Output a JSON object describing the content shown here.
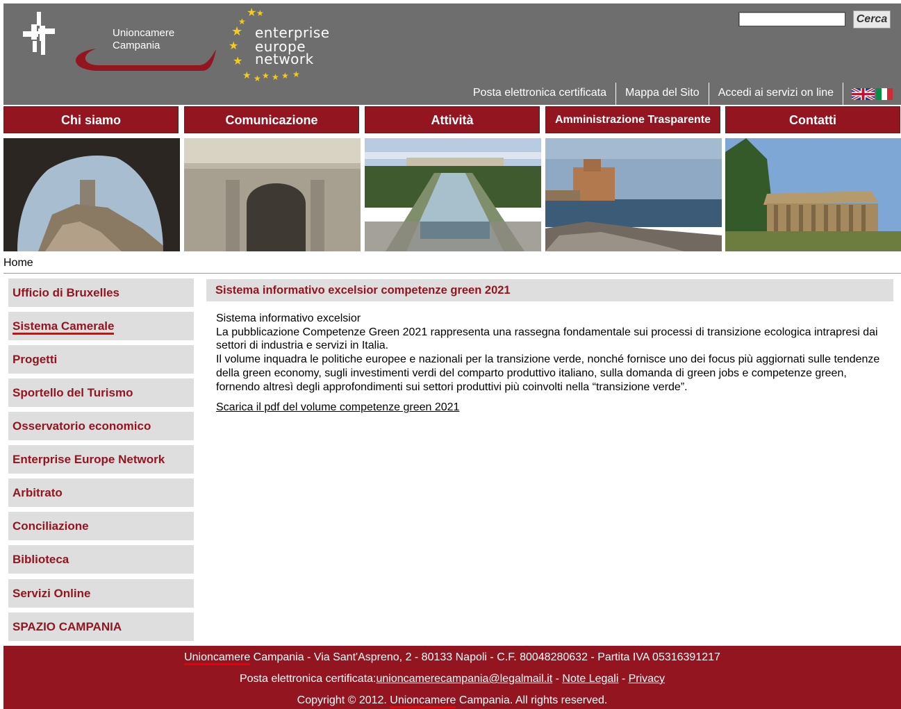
{
  "header": {
    "logo_uc_lines": [
      "Unioncamere",
      "Campania"
    ],
    "logo_een_lines": [
      "enterprise",
      "europe",
      "network"
    ],
    "search": {
      "value": "",
      "button_label": "Cerca"
    },
    "top_links": [
      "Posta elettronica certificata",
      "Mappa del Sito",
      "Accedi ai servizi on line"
    ],
    "flags": [
      "uk-flag-icon",
      "italy-flag-icon"
    ]
  },
  "nav": {
    "items": [
      "Chi siamo",
      "Comunicazione",
      "Attività",
      "Amministrazione Trasparente",
      "Contatti"
    ]
  },
  "photos": [
    "arch-ruins-photo",
    "roman-arch-photo",
    "palace-gardens-photo",
    "castle-by-sea-photo",
    "greek-temple-photo"
  ],
  "breadcrumb": "Home",
  "sidebar": {
    "items": [
      "Ufficio di Bruxelles",
      "Sistema Camerale",
      "Progetti",
      "Sportello del Turismo",
      "Osservatorio economico",
      "Enterprise Europe Network",
      "Arbitrato",
      "Conciliazione",
      "Biblioteca",
      "Servizi Online",
      "SPAZIO CAMPANIA"
    ]
  },
  "content": {
    "title": "Sistema informativo excelsior competenze green 2021",
    "subtitle": "Sistema informativo excelsior",
    "paragraph1": "La pubblicazione Competenze Green 2021 rappresenta una rassegna fondamentale sui processi di transizione ecologica intrapresi dai settori di industria e servizi in Italia.",
    "paragraph2": "Il volume inquadra le politiche europee e nazionali per la transizione verde, nonché fornisce uno dei focus più aggiornati sulle tendenze della green economy, sugli investimenti verdi del comparto produttivo italiano, sulla domanda di green jobs e competenze green, fornendo altresì degli approfondimenti sui settori produttivi più coinvolti nella “transizione verde”.",
    "download_link": "Scarica il pdf del volume competenze green 2021"
  },
  "footer": {
    "line1_brand": "Unioncamere",
    "line1_rest": " Campania - Via Sant'Aspreno, 2 - 80133 Napoli - C.F. 80048280632 - Partita IVA 05316391217",
    "line2_prefix": "Posta elettronica certificata:",
    "line2_email": "unioncamerecampania@legalmail.it",
    "line2_sep1": " - ",
    "line2_legal": "Note Legali",
    "line2_sep2": " - ",
    "line2_privacy": "Privacy",
    "line3_prefix": "Copyright © 2012. ",
    "line3_brand": "Unioncamere",
    "line3_rest": " Campania. All rights reserved."
  },
  "colors": {
    "brand": "#931520",
    "header_gray": "#6e6e6e",
    "sidebar_gray": "#dedede",
    "highlight_red": "#e00000"
  }
}
